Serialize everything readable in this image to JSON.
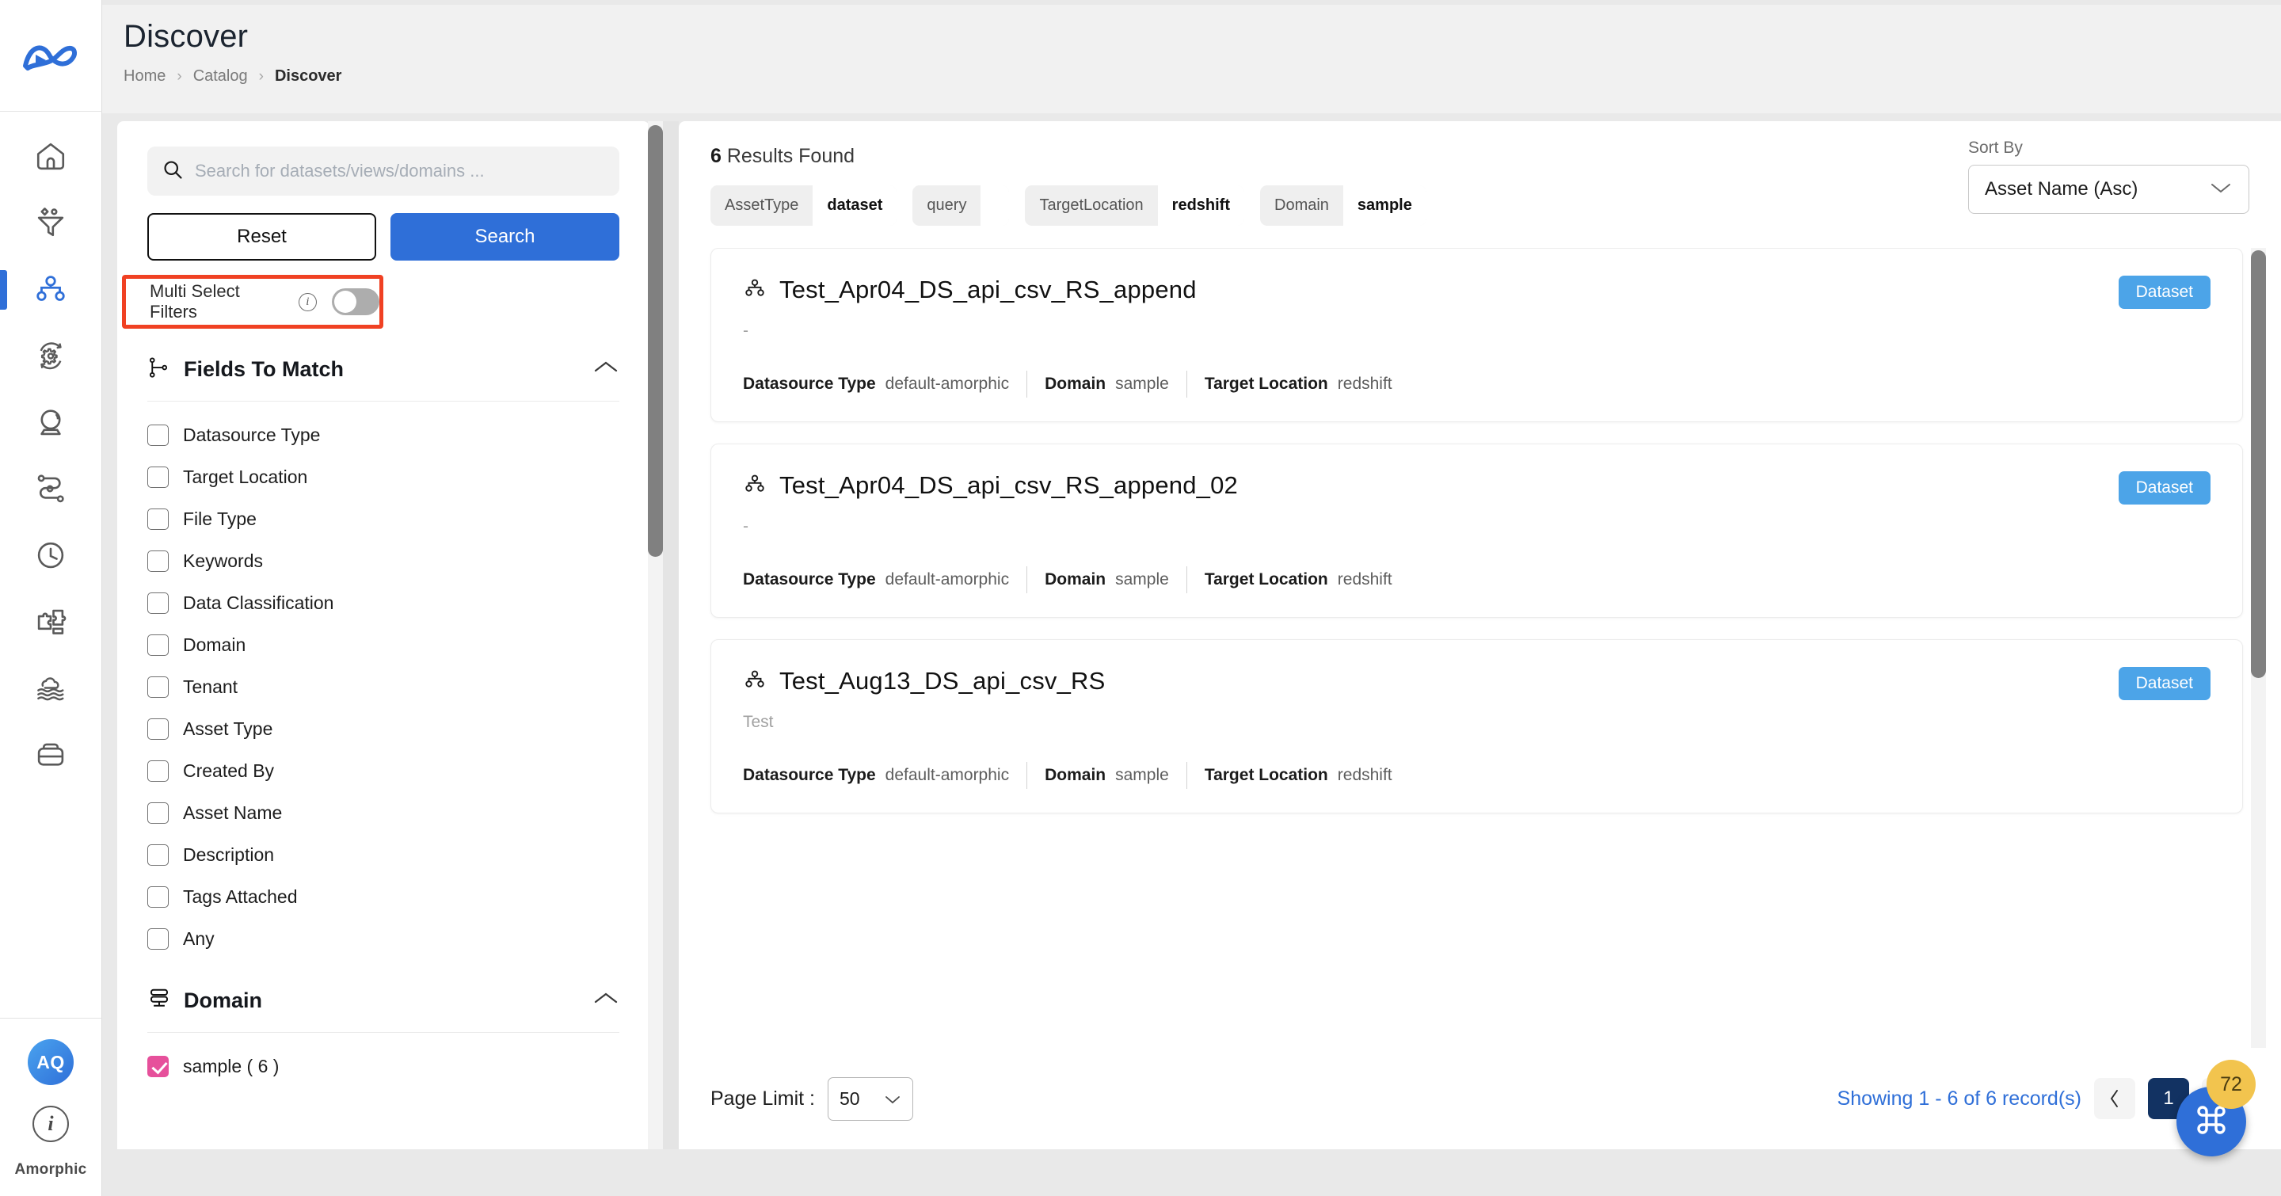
{
  "nav": {
    "logo_icon": "amorphic-logo-icon",
    "items": [
      {
        "icon": "home-icon",
        "name": "home",
        "active": false
      },
      {
        "icon": "funnel-ingest-icon",
        "name": "ingestion",
        "active": false
      },
      {
        "icon": "catalog-nodes-icon",
        "name": "catalog",
        "active": true
      },
      {
        "icon": "automation-gear-icon",
        "name": "automation",
        "active": false
      },
      {
        "icon": "crystal-ball-icon",
        "name": "insights",
        "active": false
      },
      {
        "icon": "pipeline-path-icon",
        "name": "workflows",
        "active": false
      },
      {
        "icon": "clock-icon",
        "name": "schedules",
        "active": false
      },
      {
        "icon": "puzzle-icon",
        "name": "integrations",
        "active": false
      },
      {
        "icon": "datalake-cloud-icon",
        "name": "datalake",
        "active": false
      },
      {
        "icon": "bucket-icon",
        "name": "storage",
        "active": false
      }
    ],
    "avatar_initials": "AQ",
    "info_glyph": "i",
    "brand": "Amorphic"
  },
  "header": {
    "title": "Discover",
    "breadcrumb": [
      {
        "label": "Home",
        "current": false
      },
      {
        "label": "Catalog",
        "current": false
      },
      {
        "label": "Discover",
        "current": true
      }
    ],
    "separator": "›"
  },
  "filters": {
    "search": {
      "icon": "search-icon",
      "value": "",
      "placeholder": "Search for datasets/views/domains ..."
    },
    "reset_label": "Reset",
    "search_label": "Search",
    "multi_select": {
      "label": "Multi Select Filters",
      "info_glyph": "i",
      "enabled": false,
      "highlight_color": "#f04123"
    },
    "sections": [
      {
        "title": "Fields To Match",
        "icon": "fields-to-match-icon",
        "collapse_icon": "chevron-up-icon",
        "expanded": true,
        "options": [
          {
            "label": "Datasource Type",
            "checked": false
          },
          {
            "label": "Target Location",
            "checked": false
          },
          {
            "label": "File Type",
            "checked": false
          },
          {
            "label": "Keywords",
            "checked": false
          },
          {
            "label": "Data Classification",
            "checked": false
          },
          {
            "label": "Domain",
            "checked": false
          },
          {
            "label": "Tenant",
            "checked": false
          },
          {
            "label": "Asset Type",
            "checked": false
          },
          {
            "label": "Created By",
            "checked": false
          },
          {
            "label": "Asset Name",
            "checked": false
          },
          {
            "label": "Description",
            "checked": false
          },
          {
            "label": "Tags Attached",
            "checked": false
          },
          {
            "label": "Any",
            "checked": false
          }
        ]
      },
      {
        "title": "Domain",
        "icon": "domain-icon",
        "collapse_icon": "chevron-up-icon",
        "expanded": true,
        "options": [
          {
            "label": "sample ( 6 )",
            "checked": true
          }
        ]
      }
    ]
  },
  "results": {
    "count_number": "6",
    "count_suffix": " Results Found",
    "chips": [
      {
        "key": "AssetType",
        "value": "dataset"
      },
      {
        "key": "query",
        "value": ""
      },
      {
        "key": "TargetLocation",
        "value": "redshift"
      },
      {
        "key": "Domain",
        "value": "sample"
      }
    ],
    "sort": {
      "label": "Sort By",
      "value": "Asset Name (Asc)",
      "chevron_icon": "chevron-down-icon"
    },
    "cards": [
      {
        "icon": "dataset-nodes-icon",
        "title": "Test_Apr04_DS_api_csv_RS_append",
        "description": "-",
        "badge": "Dataset",
        "meta": [
          {
            "key": "Datasource Type",
            "value": "default-amorphic"
          },
          {
            "key": "Domain",
            "value": "sample"
          },
          {
            "key": "Target Location",
            "value": "redshift"
          }
        ]
      },
      {
        "icon": "dataset-nodes-icon",
        "title": "Test_Apr04_DS_api_csv_RS_append_02",
        "description": "-",
        "badge": "Dataset",
        "meta": [
          {
            "key": "Datasource Type",
            "value": "default-amorphic"
          },
          {
            "key": "Domain",
            "value": "sample"
          },
          {
            "key": "Target Location",
            "value": "redshift"
          }
        ]
      },
      {
        "icon": "dataset-nodes-icon",
        "title": "Test_Aug13_DS_api_csv_RS",
        "description": "Test",
        "badge": "Dataset",
        "meta": [
          {
            "key": "Datasource Type",
            "value": "default-amorphic"
          },
          {
            "key": "Domain",
            "value": "sample"
          },
          {
            "key": "Target Location",
            "value": "redshift"
          }
        ]
      }
    ],
    "footer": {
      "page_limit_label": "Page Limit :",
      "page_limit_value": "50",
      "page_limit_chevron": "chevron-down-icon",
      "showing_text": "Showing 1 - 6 of 6 record(s)",
      "prev_icon": "chevron-left-icon",
      "next_icon": "chevron-right-icon",
      "current_page": "1"
    }
  },
  "fab": {
    "icon": "command-key-icon",
    "badge_count": "72",
    "color": "#2f6fd8",
    "badge_color": "#f2c44e"
  }
}
